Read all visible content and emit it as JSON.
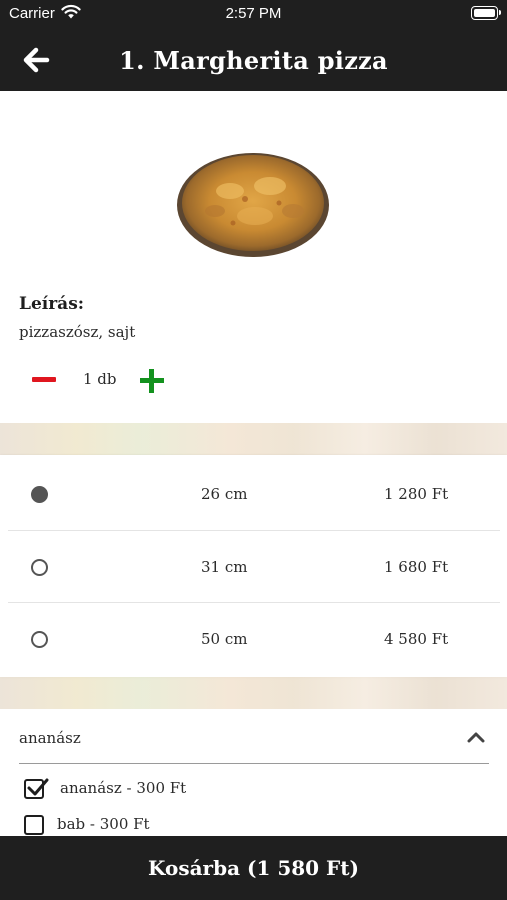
{
  "status_bar": {
    "carrier": "Carrier",
    "time": "2:57 PM"
  },
  "header": {
    "title": "1. Margherita pizza",
    "back_icon": "arrow-left-icon"
  },
  "product": {
    "image": "pizza-photo",
    "description_label": "Leírás:",
    "description": "pizzaszósz, sajt",
    "quantity": "1 db",
    "minus_color": "#e0161f",
    "plus_color": "#13921e"
  },
  "sizes": [
    {
      "size": "26 cm",
      "price": "1 280 Ft",
      "selected": true
    },
    {
      "size": "31 cm",
      "price": "1 680 Ft",
      "selected": false
    },
    {
      "size": "50 cm",
      "price": "4 580 Ft",
      "selected": false
    }
  ],
  "toppings": {
    "group_title": "ananász",
    "expanded": true,
    "items": [
      {
        "label": "ananász - 300 Ft",
        "checked": true
      },
      {
        "label": "bab - 300 Ft",
        "checked": false
      }
    ]
  },
  "cart": {
    "label": "Kosárba (1 580 Ft)"
  },
  "colors": {
    "bar_background": "#1f1f1f",
    "text": "#1e1e1e"
  }
}
